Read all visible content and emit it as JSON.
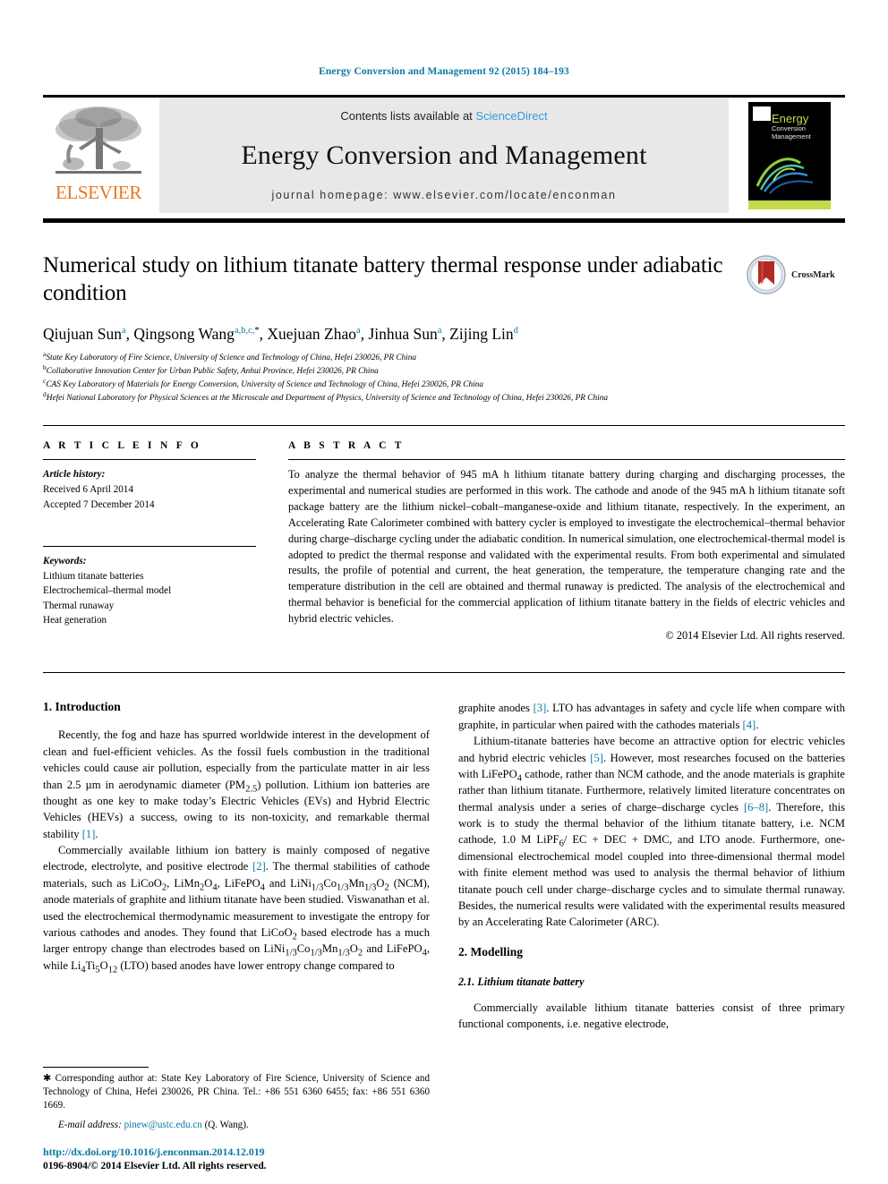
{
  "running_head": "Energy Conversion and Management 92 (2015) 184–193",
  "masthead": {
    "publisher_logo_text": "ELSEVIER",
    "contents_prefix": "Contents lists available at ",
    "contents_link": "ScienceDirect",
    "journal_title": "Energy Conversion and Management",
    "homepage_line": "journal homepage: www.elsevier.com/locate/enconman",
    "cover": {
      "line1": "Energy",
      "line2": "Conversion",
      "line3": "Management"
    }
  },
  "article": {
    "title": "Numerical study on lithium titanate battery thermal response under adiabatic condition",
    "crossmark_label": "CrossMark",
    "authors_html": "Qiujuan Sun<sup>a</sup>, Qingsong Wang<sup>a,b,c,</sup><sup class=\"star\">*</sup>, Xuejuan Zhao<sup>a</sup>, Jinhua Sun<sup>a</sup>, Zijing Lin<sup>d</sup>",
    "affiliations": [
      {
        "marker": "a",
        "text": "State Key Laboratory of Fire Science, University of Science and Technology of China, Hefei 230026, PR China"
      },
      {
        "marker": "b",
        "text": "Collaborative Innovation Center for Urban Public Safety, Anhui Province, Hefei 230026, PR China"
      },
      {
        "marker": "c",
        "text": "CAS Key Laboratory of Materials for Energy Conversion, University of Science and Technology of China, Hefei 230026, PR China"
      },
      {
        "marker": "d",
        "text": "Hefei National Laboratory for Physical Sciences at the Microscale and Department of Physics, University of Science and Technology of China, Hefei 230026, PR China"
      }
    ]
  },
  "info": {
    "heading": "A R T I C L E    I N F O",
    "history_label": "Article history:",
    "history": [
      "Received 6 April 2014",
      "Accepted 7 December 2014"
    ],
    "keywords_label": "Keywords:",
    "keywords": [
      "Lithium titanate batteries",
      "Electrochemical–thermal model",
      "Thermal runaway",
      "Heat generation"
    ]
  },
  "abstract": {
    "heading": "A B S T R A C T",
    "text": "To analyze the thermal behavior of 945 mA h lithium titanate battery during charging and discharging processes, the experimental and numerical studies are performed in this work. The cathode and anode of the 945 mA h lithium titanate soft package battery are the lithium nickel–cobalt–manganese-oxide and lithium titanate, respectively. In the experiment, an Accelerating Rate Calorimeter combined with battery cycler is employed to investigate the electrochemical–thermal behavior during charge–discharge cycling under the adiabatic condition. In numerical simulation, one electrochemical-thermal model is adopted to predict the thermal response and validated with the experimental results. From both experimental and simulated results, the profile of potential and current, the heat generation, the temperature, the temperature changing rate and the temperature distribution in the cell are obtained and thermal runaway is predicted. The analysis of the electrochemical and thermal behavior is beneficial for the commercial application of lithium titanate battery in the fields of electric vehicles and hybrid electric vehicles.",
    "copyright": "© 2014 Elsevier Ltd. All rights reserved."
  },
  "body": {
    "section1_heading": "1. Introduction",
    "p1_html": "Recently, the fog and haze has spurred worldwide interest in the development of clean and fuel-efficient vehicles. As the fossil fuels combustion in the traditional vehicles could cause air pollution, especially from the particulate matter in air less than 2.5 &micro;m in aerodynamic diameter (PM<sub>2.5</sub>) pollution. Lithium ion batteries are thought as one key to make today&rsquo;s Electric Vehicles (EVs) and Hybrid Electric Vehicles (HEVs) a success, owing to its non-toxicity, and remarkable thermal stability <span class=\"ref\">[1]</span>.",
    "p2_html": "Commercially available lithium ion battery is mainly composed of negative electrode, electrolyte, and positive electrode <span class=\"ref\">[2]</span>. The thermal stabilities of cathode materials, such as LiCoO<sub>2</sub>, LiMn<sub>2</sub>O<sub>4</sub>, LiFePO<sub>4</sub> and LiNi<sub>1/3</sub>Co<sub>1/3</sub>Mn<sub>1/3</sub>O<sub>2</sub> (NCM), anode materials of graphite and lithium titanate have been studied. Viswanathan et al. used the electrochemical thermodynamic measurement to investigate the entropy for various cathodes and anodes. They found that LiCoO<sub>2</sub> based electrode has a much larger entropy change than electrodes based on LiNi<sub>1/3</sub>Co<sub>1/3</sub>Mn<sub>1/3</sub>O<sub>2</sub> and LiFePO<sub>4</sub>, while Li<sub>4</sub>Ti<sub>5</sub>O<sub>12</sub> (LTO) based anodes have lower entropy change compared to",
    "p3_html": "graphite anodes <span class=\"ref\">[3]</span>. LTO has advantages in safety and cycle life when compare with graphite, in particular when paired with the cathodes materials <span class=\"ref\">[4]</span>.",
    "p4_html": "Lithium-titanate batteries have become an attractive option for electric vehicles and hybrid electric vehicles <span class=\"ref\">[5]</span>. However, most researches focused on the batteries with LiFePO<sub>4</sub> cathode, rather than NCM cathode, and the anode materials is graphite rather than lithium titanate. Furthermore, relatively limited literature concentrates on thermal analysis under a series of charge–discharge cycles <span class=\"ref\">[6–8]</span>. Therefore, this work is to study the thermal behavior of the lithium titanate battery, i.e. NCM cathode, 1.0 M LiPF<sub>6</sub>/ EC + DEC + DMC, and LTO anode. Furthermore, one-dimensional electrochemical model coupled into three-dimensional thermal model with finite element method was used to analysis the thermal behavior of lithium titanate pouch cell under charge–discharge cycles and to simulate thermal runaway. Besides, the numerical results were validated with the experimental results measured by an Accelerating Rate Calorimeter (ARC).",
    "section2_heading": "2. Modelling",
    "subsection21_heading": "2.1. Lithium titanate battery",
    "p5_html": "Commercially available lithium titanate batteries consist of three primary functional components, i.e. negative electrode,"
  },
  "footnotes": {
    "corresponding_html": "&#10033; Corresponding author at: State Key Laboratory of Fire Science, University of Science and Technology of China, Hefei 230026, PR China. Tel.: +86 551 6360 6455; fax: +86 551 6360 1669.",
    "email_html": "<em>E-mail address:</em> <a href=\"#\">pinew@ustc.edu.cn</a> (Q. Wang).",
    "doi": "http://dx.doi.org/10.1016/j.enconman.2014.12.019",
    "issn_line": "0196-8904/© 2014 Elsevier Ltd. All rights reserved."
  },
  "colors": {
    "link_blue": "#0b7aa5",
    "sciencedirect_blue": "#3a9ad9",
    "elsevier_orange": "#E87722",
    "cover_green": "#c6d94b"
  }
}
